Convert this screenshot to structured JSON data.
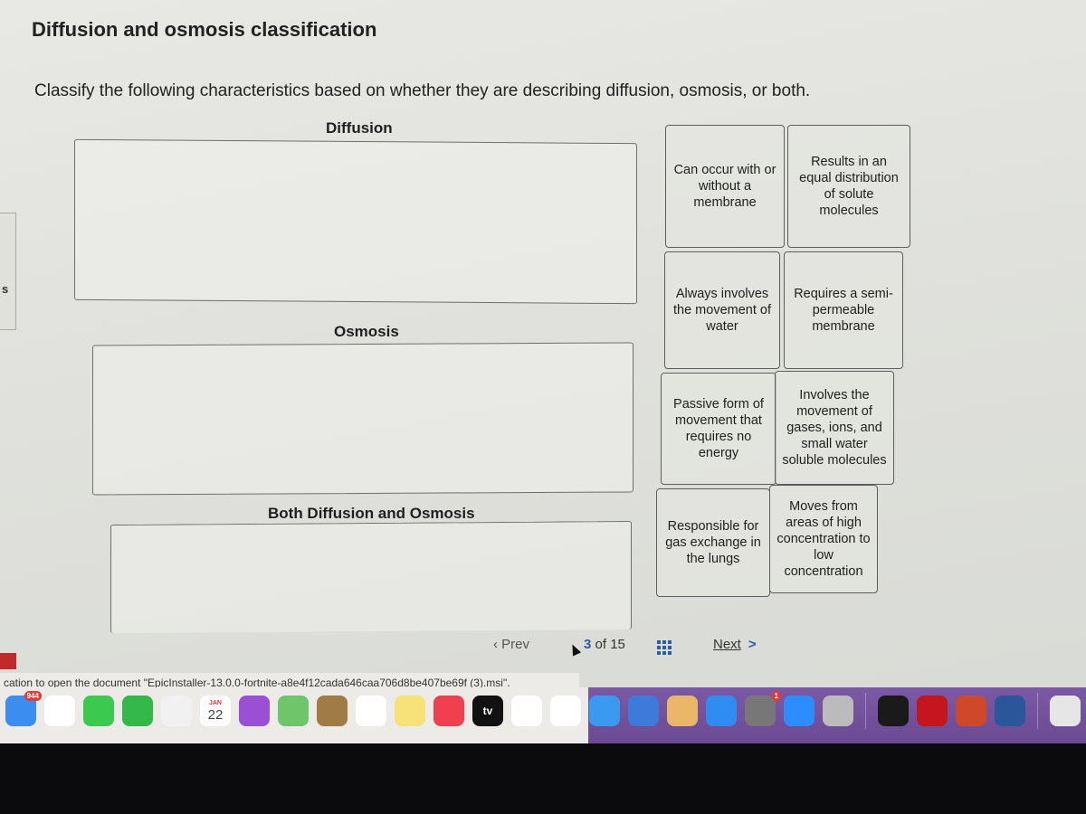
{
  "page": {
    "title": "Diffusion and osmosis classification",
    "instructions": "Classify the following characteristics based on whether they are describing diffusion, osmosis, or both."
  },
  "categories": [
    {
      "label": "Diffusion"
    },
    {
      "label": "Osmosis"
    },
    {
      "label": "Both Diffusion and Osmosis"
    }
  ],
  "cards": [
    {
      "text": "Can occur with or without a membrane"
    },
    {
      "text": "Results in an equal distribution of solute molecules"
    },
    {
      "text": "Always involves the movement of water"
    },
    {
      "text": "Requires a semi-permeable membrane"
    },
    {
      "text": "Passive form of movement that requires no energy"
    },
    {
      "text": "Involves the movement of gases, ions, and small water soluble molecules"
    },
    {
      "text": "Responsible for gas exchange in the lungs"
    },
    {
      "text": "Moves from areas of high concentration to low concentration"
    }
  ],
  "navigation": {
    "prev_label": "Prev",
    "current_page": "3",
    "of_label": "of",
    "total_pages": "15",
    "next_label": "Next",
    "next_icon": "chevron-right-icon",
    "grid_icon": "grid-icon"
  },
  "left_edge_text": "s",
  "system_notice": "cation to open the document \"EpicInstaller-13.0.0-fortnite-a8e4f12cada646caa706d8be407be69f (3).msi\".",
  "dock": {
    "items": [
      {
        "name": "mail",
        "badge": "944",
        "color": "#3b8ef0"
      },
      {
        "name": "chrome",
        "color": "#ffffff"
      },
      {
        "name": "messages",
        "color": "#3cc94f"
      },
      {
        "name": "facetime",
        "color": "#34b84a"
      },
      {
        "name": "photos",
        "color": "#f1f1f1"
      },
      {
        "name": "calendar",
        "month": "JAN",
        "day": "22",
        "color": "#ffffff"
      },
      {
        "name": "podcasts",
        "color": "#9b4fd4"
      },
      {
        "name": "maps",
        "color": "#6fc66a"
      },
      {
        "name": "notebook",
        "color": "#a07b45"
      },
      {
        "name": "reminders",
        "color": "#ffffff"
      },
      {
        "name": "notes",
        "color": "#f7e27a"
      },
      {
        "name": "music",
        "color": "#f0404f"
      },
      {
        "name": "apple-tv",
        "label": "tv",
        "color": "#111111"
      },
      {
        "name": "news",
        "color": "#ffffff"
      },
      {
        "name": "numbers",
        "color": "#ffffff"
      },
      {
        "name": "safari",
        "color": "#3a9af0"
      },
      {
        "name": "keynote",
        "color": "#3d7ad9"
      },
      {
        "name": "preview",
        "color": "#e9b66a"
      },
      {
        "name": "app-store",
        "color": "#2f8df2"
      },
      {
        "name": "system-preferences",
        "badge": "1",
        "color": "#777777"
      },
      {
        "name": "zoom",
        "color": "#2d8cff"
      },
      {
        "name": "unknown-app",
        "color": "#bbbbbb"
      },
      {
        "name": "terminal",
        "color": "#1a1a1a"
      },
      {
        "name": "acrobat",
        "color": "#c4161c"
      },
      {
        "name": "powerpoint",
        "color": "#d0482a"
      },
      {
        "name": "word",
        "color": "#2b579a"
      },
      {
        "name": "document-file",
        "color": "#e6e6e6"
      },
      {
        "name": "disk-image-file",
        "color": "#e0e0e0"
      }
    ]
  }
}
